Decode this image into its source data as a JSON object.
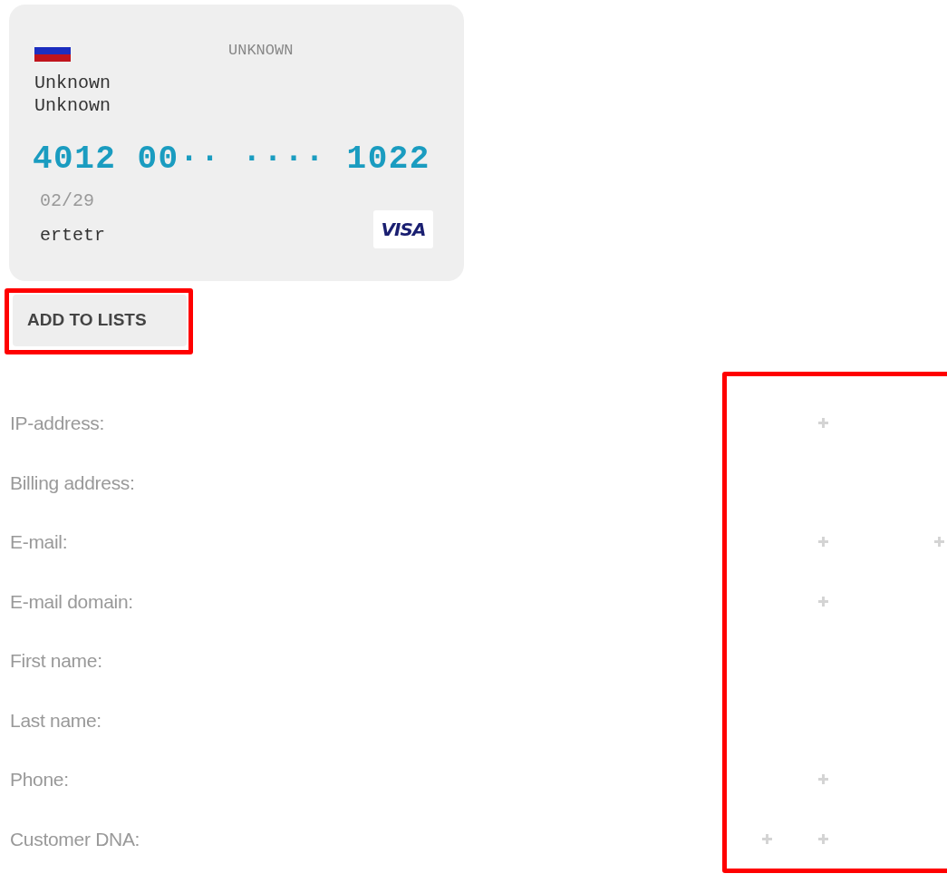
{
  "card": {
    "scheme": "UNKNOWN",
    "lines": [
      "Unknown",
      "Unknown"
    ],
    "number": "4012 00·· ···· 1022",
    "expiry": "02/29",
    "holder": "ertetr",
    "brand": "VISA"
  },
  "add_button": {
    "label": "ADD TO LISTS",
    "highlighted": true
  },
  "fields": [
    {
      "label": "IP-address:",
      "add_slots": [
        {
          "shown": false
        },
        {
          "shown": true
        },
        {
          "shown": false
        }
      ]
    },
    {
      "label": "Billing address:",
      "add_slots": [
        {
          "shown": false
        },
        {
          "shown": false
        },
        {
          "shown": false
        }
      ]
    },
    {
      "label": "E-mail:",
      "add_slots": [
        {
          "shown": false
        },
        {
          "shown": true
        },
        {
          "shown": true
        }
      ]
    },
    {
      "label": "E-mail domain:",
      "add_slots": [
        {
          "shown": false
        },
        {
          "shown": true
        },
        {
          "shown": false
        }
      ]
    },
    {
      "label": "First name:",
      "add_slots": [
        {
          "shown": false
        },
        {
          "shown": false
        },
        {
          "shown": false
        }
      ]
    },
    {
      "label": "Last name:",
      "add_slots": [
        {
          "shown": false
        },
        {
          "shown": false
        },
        {
          "shown": false
        }
      ]
    },
    {
      "label": "Phone:",
      "add_slots": [
        {
          "shown": false
        },
        {
          "shown": true
        },
        {
          "shown": false
        }
      ]
    },
    {
      "label": "Customer DNA:",
      "add_slots": [
        {
          "shown": true
        },
        {
          "shown": true
        },
        {
          "shown": false
        }
      ]
    }
  ],
  "actions_highlighted": true
}
